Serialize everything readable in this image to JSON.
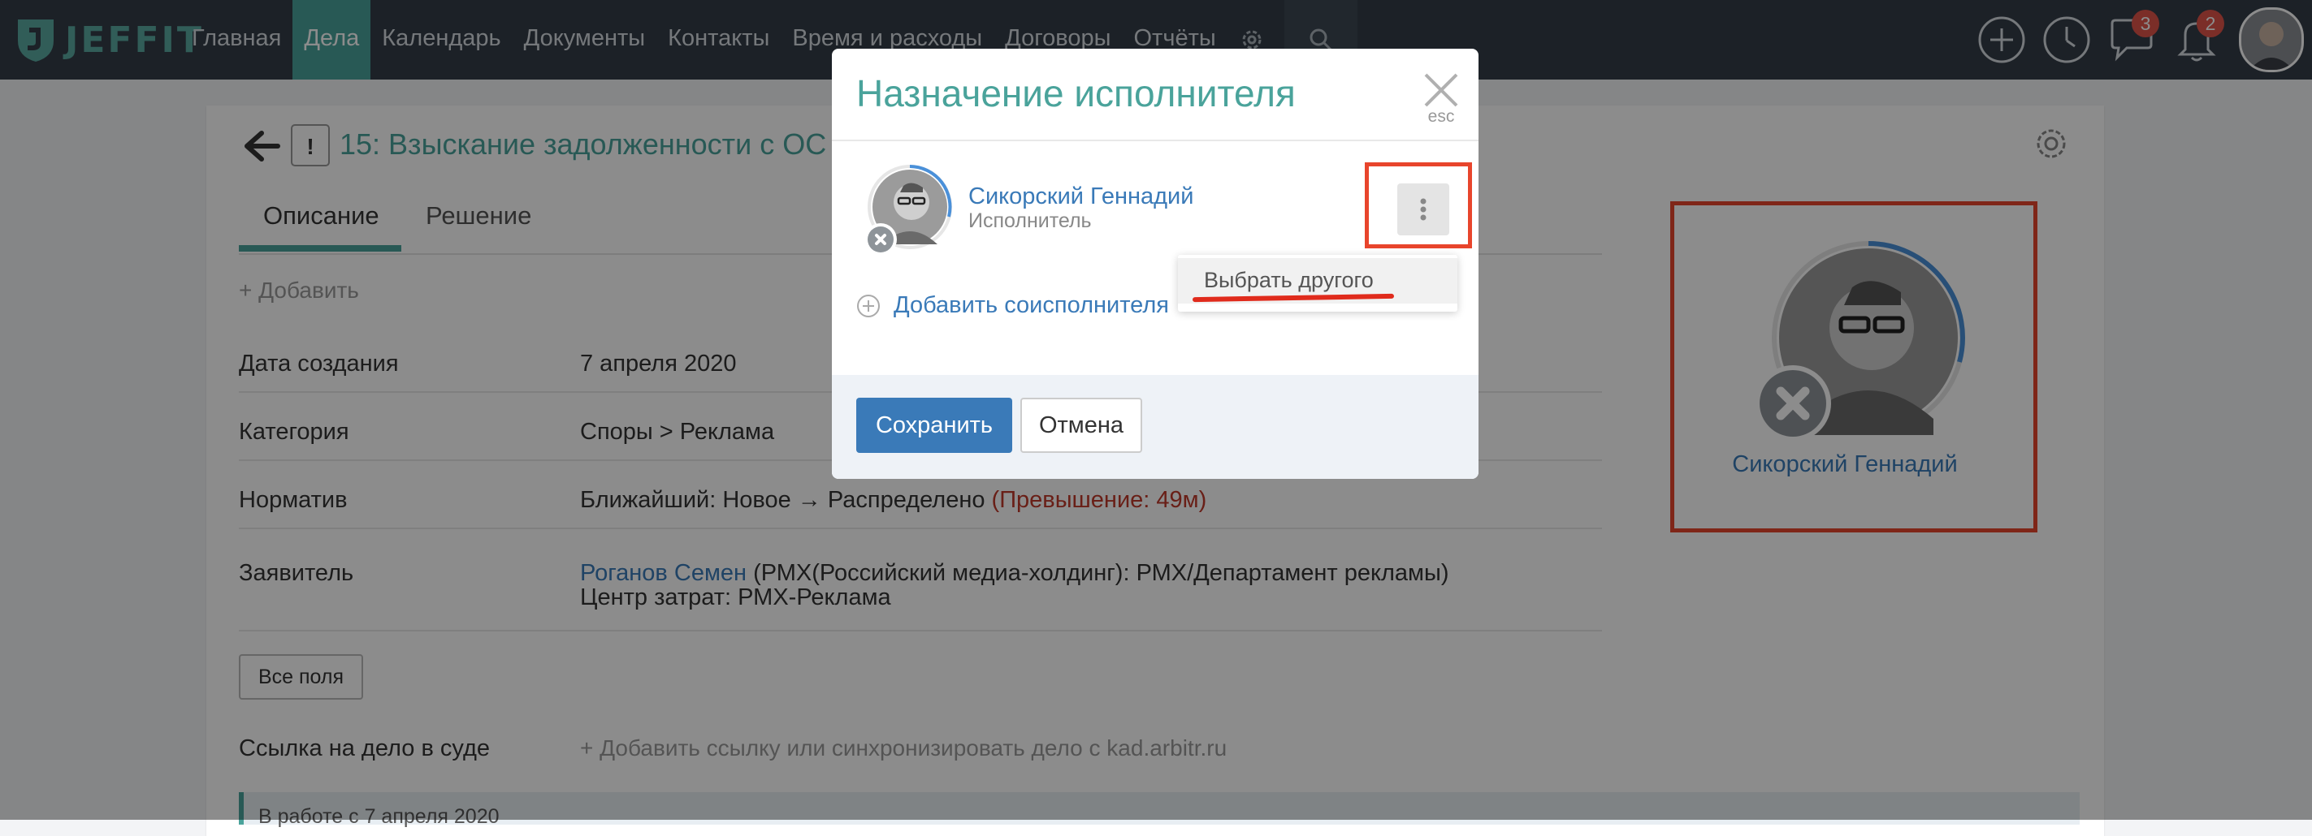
{
  "app": {
    "brand": "JEFFIT"
  },
  "nav": {
    "items": [
      "Главная",
      "Дела",
      "Календарь",
      "Документы",
      "Контакты",
      "Время и расходы",
      "Договоры",
      "Отчёты"
    ],
    "active": "Дела"
  },
  "header_icons": {
    "messages_badge": "3",
    "notifications_badge": "2"
  },
  "task": {
    "number_title": "15: Взыскание задолженности с ОС",
    "tabs": [
      "Описание",
      "Решение"
    ],
    "add_label": "+ Добавить",
    "fields": [
      {
        "label": "Дата создания",
        "value": "7 апреля 2020"
      },
      {
        "label": "Категория",
        "value": "Споры > Реклама"
      },
      {
        "label": "Норматив",
        "value": "Ближайший: Новое → Распределено",
        "extra": "(Превышение: 49м)"
      },
      {
        "label": "Заявитель",
        "value": "Роганов Семен",
        "extra": "(РМХ(Российский медиа-холдинг): РМХ/Департамент рекламы)",
        "line2": "Центр затрат: РМХ-Реклама"
      }
    ],
    "all_fields_button": "Все поля",
    "court_link_label": "Ссылка на дело в суде",
    "court_link_value": "+ Добавить ссылку или синхронизировать дело с kad.arbitr.ru",
    "status_strip": "В работе с 7 апреля 2020"
  },
  "assignee": {
    "name": "Сикорский Геннадий"
  },
  "modal": {
    "title": "Назначение исполнителя",
    "close_hint": "esc",
    "person_name": "Сикорский Геннадий",
    "person_role": "Исполнитель",
    "add_coexecutor": "Добавить соисполнителя",
    "dropdown_item": "Выбрать другого",
    "save": "Сохранить",
    "cancel": "Отмена"
  },
  "colors": {
    "accent": "#4aa39b",
    "link": "#3a7ab8",
    "primary_button": "#3a7ab8",
    "highlight_red": "#e8452c",
    "topbar": "#333d48"
  }
}
